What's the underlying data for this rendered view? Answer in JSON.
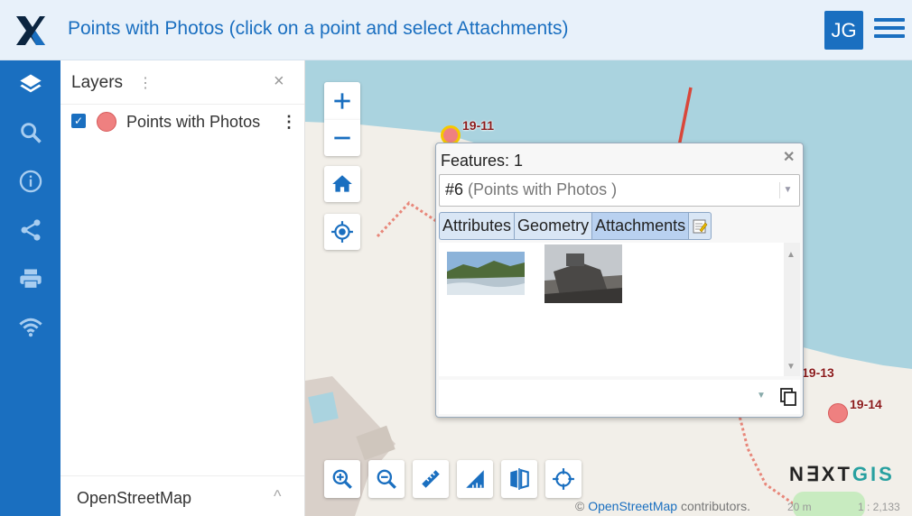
{
  "header": {
    "title": "Points with Photos (click on a point and select Attachments)",
    "user_initials": "JG"
  },
  "sidebar": {
    "items": [
      {
        "name": "layers-icon"
      },
      {
        "name": "search-icon"
      },
      {
        "name": "info-icon"
      },
      {
        "name": "share-icon"
      },
      {
        "name": "print-icon"
      },
      {
        "name": "wifi-icon"
      }
    ]
  },
  "layers_panel": {
    "title": "Layers",
    "layers": [
      {
        "label": "Points with Photos",
        "checked": true,
        "color": "#ef8080"
      }
    ],
    "basemap": "OpenStreetMap"
  },
  "map": {
    "points": [
      {
        "label": "19-11",
        "highlight": true
      },
      {
        "label": "19-13"
      },
      {
        "label": "19-14"
      }
    ],
    "attribution_prefix": "©",
    "attribution_link": "OpenStreetMap",
    "attribution_suffix": "contributors.",
    "scale": "20 m",
    "ratio": "1 : 2,133",
    "brand": {
      "prefix": "N∃XT",
      "suffix": "GIS"
    }
  },
  "popup": {
    "title": "Features: 1",
    "selected_feature_id": "#6",
    "selected_feature_layer": "(Points with Photos )",
    "tabs": [
      "Attributes",
      "Geometry",
      "Attachments"
    ],
    "active_tab": "Attachments"
  },
  "colors": {
    "primary": "#1a6fc0",
    "point": "#ef8080",
    "water": "#aad3df",
    "land": "#f2efe9"
  }
}
